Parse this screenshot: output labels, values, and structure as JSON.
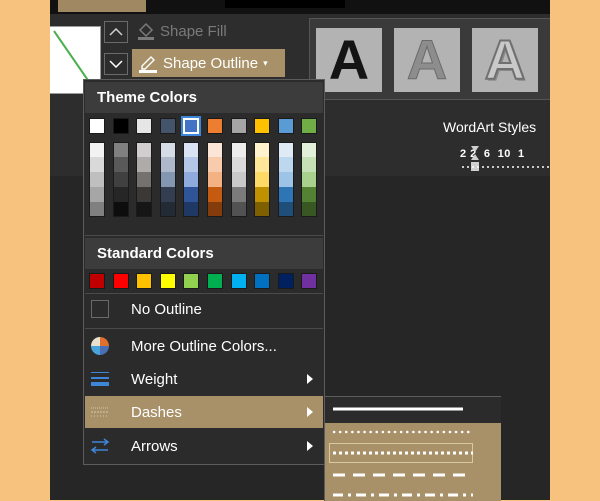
{
  "ribbon": {
    "shape_fill_label": "Shape Fill",
    "shape_outline_label": "Shape Outline",
    "wordart_letter": "A",
    "wordart_styles_label": "WordArt Styles",
    "ruler_label": "2 2  6  10  1"
  },
  "dropdown": {
    "theme_colors_title": "Theme Colors",
    "theme_colors": [
      "#ffffff",
      "#000000",
      "#e7e6e6",
      "#44546a",
      "#4472c4",
      "#ed7d31",
      "#a5a5a5",
      "#ffc000",
      "#5b9bd5",
      "#70ad47"
    ],
    "theme_shades": [
      [
        "#f2f2f2",
        "#d9d9d9",
        "#bfbfbf",
        "#a6a6a6",
        "#808080"
      ],
      [
        "#808080",
        "#595959",
        "#404040",
        "#262626",
        "#0d0d0d"
      ],
      [
        "#d0cece",
        "#aeabab",
        "#757171",
        "#3b3838",
        "#171616"
      ],
      [
        "#d6dce5",
        "#adb9ca",
        "#8497b0",
        "#333f50",
        "#222a35"
      ],
      [
        "#dae3f3",
        "#b4c7e7",
        "#8faadc",
        "#2f5597",
        "#1f3864"
      ],
      [
        "#fbe5d6",
        "#f8cbad",
        "#f4b183",
        "#c55a11",
        "#843c0c"
      ],
      [
        "#ededed",
        "#dbdbdb",
        "#c9c9c9",
        "#7b7b7b",
        "#525252"
      ],
      [
        "#fff2cc",
        "#ffe699",
        "#ffd966",
        "#bf9000",
        "#7f6000"
      ],
      [
        "#deebf7",
        "#bdd7ee",
        "#9dc3e6",
        "#2e75b6",
        "#1f4e79"
      ],
      [
        "#e2f0d9",
        "#c5e0b4",
        "#a9d18e",
        "#548235",
        "#385723"
      ]
    ],
    "selected_theme_index": 4,
    "standard_colors_title": "Standard Colors",
    "standard_colors": [
      "#c00000",
      "#ff0000",
      "#ffc000",
      "#ffff00",
      "#92d050",
      "#00b050",
      "#00b0f0",
      "#0070c0",
      "#002060",
      "#7030a0"
    ],
    "items": {
      "no_outline": "No Outline",
      "more_colors": "More Outline Colors...",
      "weight": "Weight",
      "dashes": "Dashes",
      "arrows": "Arrows"
    }
  },
  "dashes_submenu": {
    "styles": [
      "solid",
      "round-dot",
      "square-dot",
      "dash",
      "dash-dot"
    ],
    "selected_index": 2
  },
  "colors": {
    "accent": "#a89168",
    "app_background": "#262626",
    "page_background": "#f7c27d"
  }
}
